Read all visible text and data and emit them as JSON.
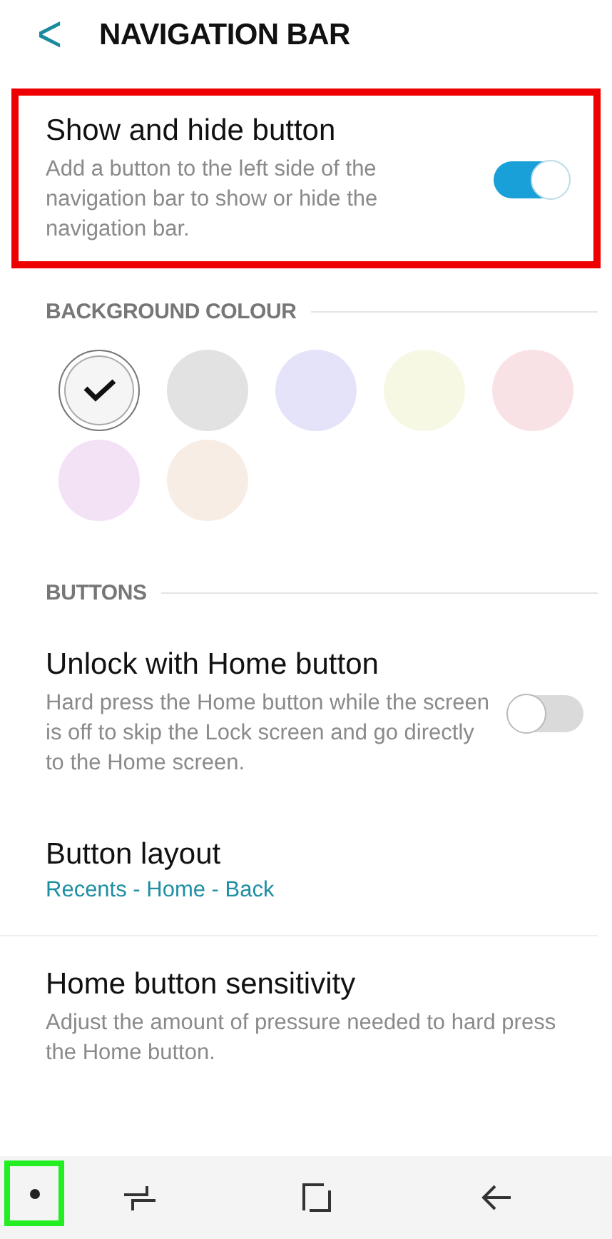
{
  "header": {
    "back": "<",
    "title": "NAVIGATION BAR"
  },
  "highlight_setting": {
    "title": "Show and hide button",
    "description": "Add a button to the left side of the navigation bar to show or hide the navigation bar.",
    "on": true,
    "highlighted": true
  },
  "background_colour": {
    "heading": "BACKGROUND COLOUR",
    "swatches": [
      {
        "color": "#f5f5f5",
        "selected": true
      },
      {
        "color": "#e2e2e2",
        "selected": false
      },
      {
        "color": "#e4e3fa",
        "selected": false
      },
      {
        "color": "#f7f8e4",
        "selected": false
      },
      {
        "color": "#f9e2e5",
        "selected": false
      },
      {
        "color": "#f3e1f6",
        "selected": false
      },
      {
        "color": "#f8ede5",
        "selected": false
      }
    ]
  },
  "buttons_section": {
    "heading": "BUTTONS",
    "items": [
      {
        "kind": "toggle",
        "title": "Unlock with Home button",
        "description": "Hard press the Home button while the screen is off to skip the Lock screen and go directly to the Home screen.",
        "on": false
      },
      {
        "kind": "value",
        "title": "Button layout",
        "value": "Recents - Home - Back"
      },
      {
        "kind": "plain",
        "title": "Home button sensitivity",
        "description": "Adjust the amount of pressure needed to hard press the Home button."
      }
    ]
  },
  "nav_bar": {
    "buttons": [
      {
        "kind": "dot",
        "highlighted": true
      },
      {
        "kind": "recents",
        "highlighted": false
      },
      {
        "kind": "home",
        "highlighted": false
      },
      {
        "kind": "back",
        "highlighted": false
      }
    ]
  }
}
